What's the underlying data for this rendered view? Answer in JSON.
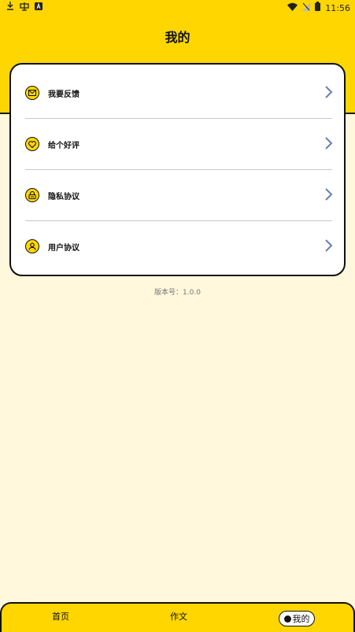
{
  "status_bar": {
    "time": "11:56",
    "left_icons": [
      "download-icon",
      "app-icon",
      "a-badge-icon"
    ],
    "right_icons": [
      "wifi-icon",
      "signal-off-icon",
      "battery-icon"
    ]
  },
  "header": {
    "title": "我的"
  },
  "menu": {
    "items": [
      {
        "label": "我要反馈",
        "icon": "mail-icon"
      },
      {
        "label": "给个好评",
        "icon": "heart-icon"
      },
      {
        "label": "隐私协议",
        "icon": "lock-icon"
      },
      {
        "label": "用户协议",
        "icon": "user-icon"
      }
    ]
  },
  "version_text": "版本号：1.0.0",
  "tabbar": {
    "home": "首页",
    "write": "作文",
    "mine": "我的"
  },
  "colors": {
    "accent": "#FFD600",
    "background": "#FFF8DC",
    "chevron": "#6b7db3"
  }
}
